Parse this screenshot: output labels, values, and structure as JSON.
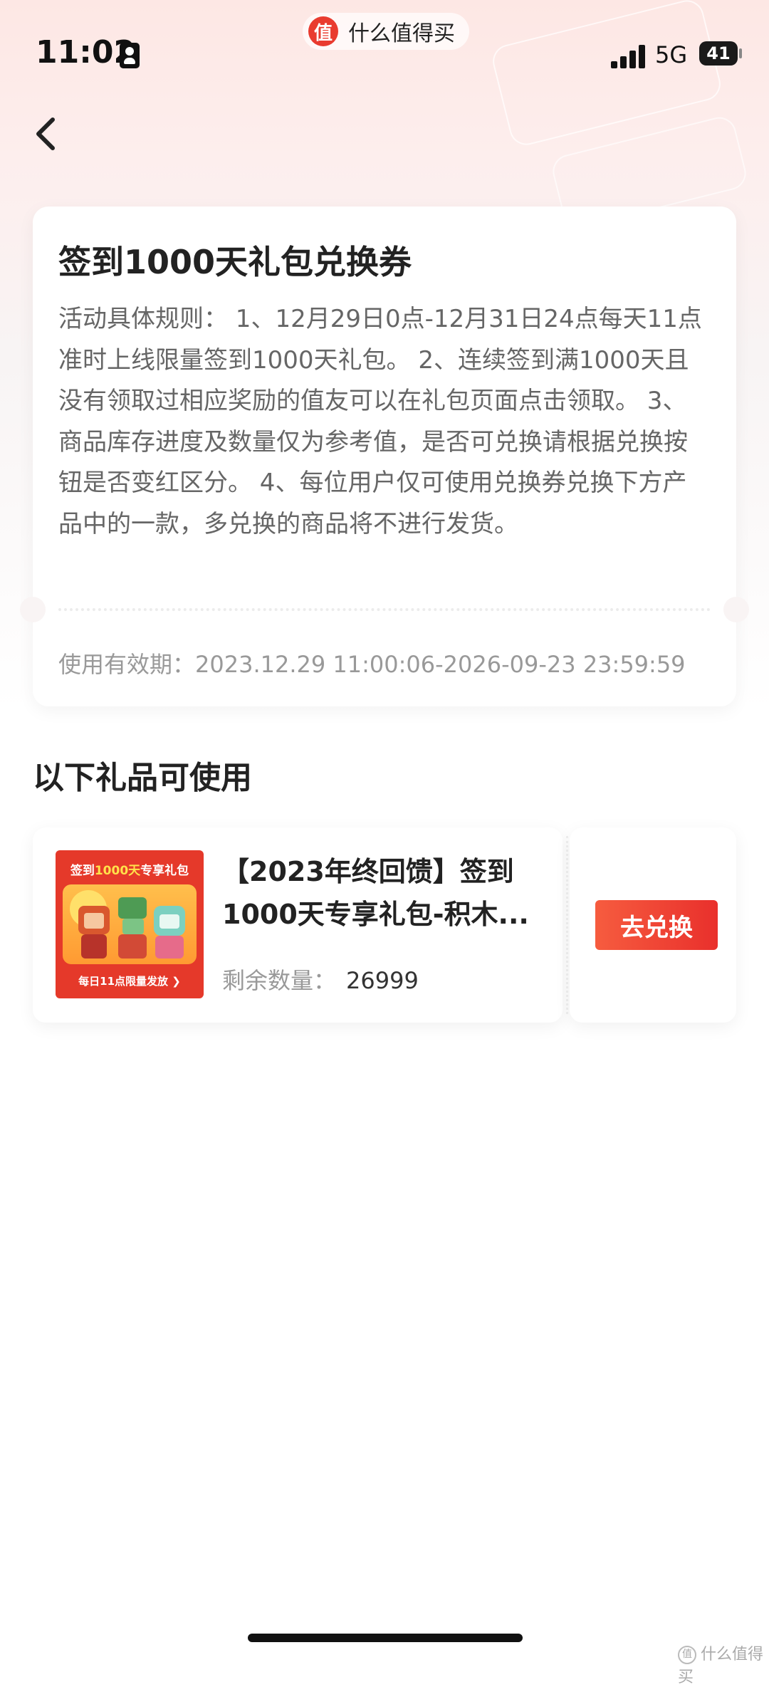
{
  "status_bar": {
    "time": "11:02",
    "network": "5G",
    "battery": "41"
  },
  "app": {
    "logo_char": "值",
    "name": "什么值得买"
  },
  "coupon": {
    "title": "签到1000天礼包兑换券",
    "rules": "活动具体规则： 1、12月29日0点-12月31日24点每天11点准时上线限量签到1000天礼包。 2、连续签到满1000天且没有领取过相应奖励的值友可以在礼包页面点击领取。 3、商品库存进度及数量仅为参考值，是否可兑换请根据兑换按钮是否变红区分。 4、每位用户仅可使用兑换券兑换下方产品中的一款，多兑换的商品将不进行发货。",
    "validity_label": "使用有效期：",
    "validity_value": "2023.12.29 11:00:06-2026-09-23 23:59:59"
  },
  "gifts_section": {
    "title": "以下礼品可使用",
    "items": [
      {
        "thumb_top_a": "签到",
        "thumb_top_b": "1000天",
        "thumb_top_c": "专享礼包",
        "thumb_bottom": "每日11点限量发放 ❯",
        "title": "【2023年终回馈】签到1000天专享礼包-积木...",
        "stock_label": "剩余数量：",
        "stock_value": "26999",
        "button": "去兑换"
      }
    ]
  },
  "watermark": {
    "icon": "值",
    "text": "什么值得买"
  }
}
